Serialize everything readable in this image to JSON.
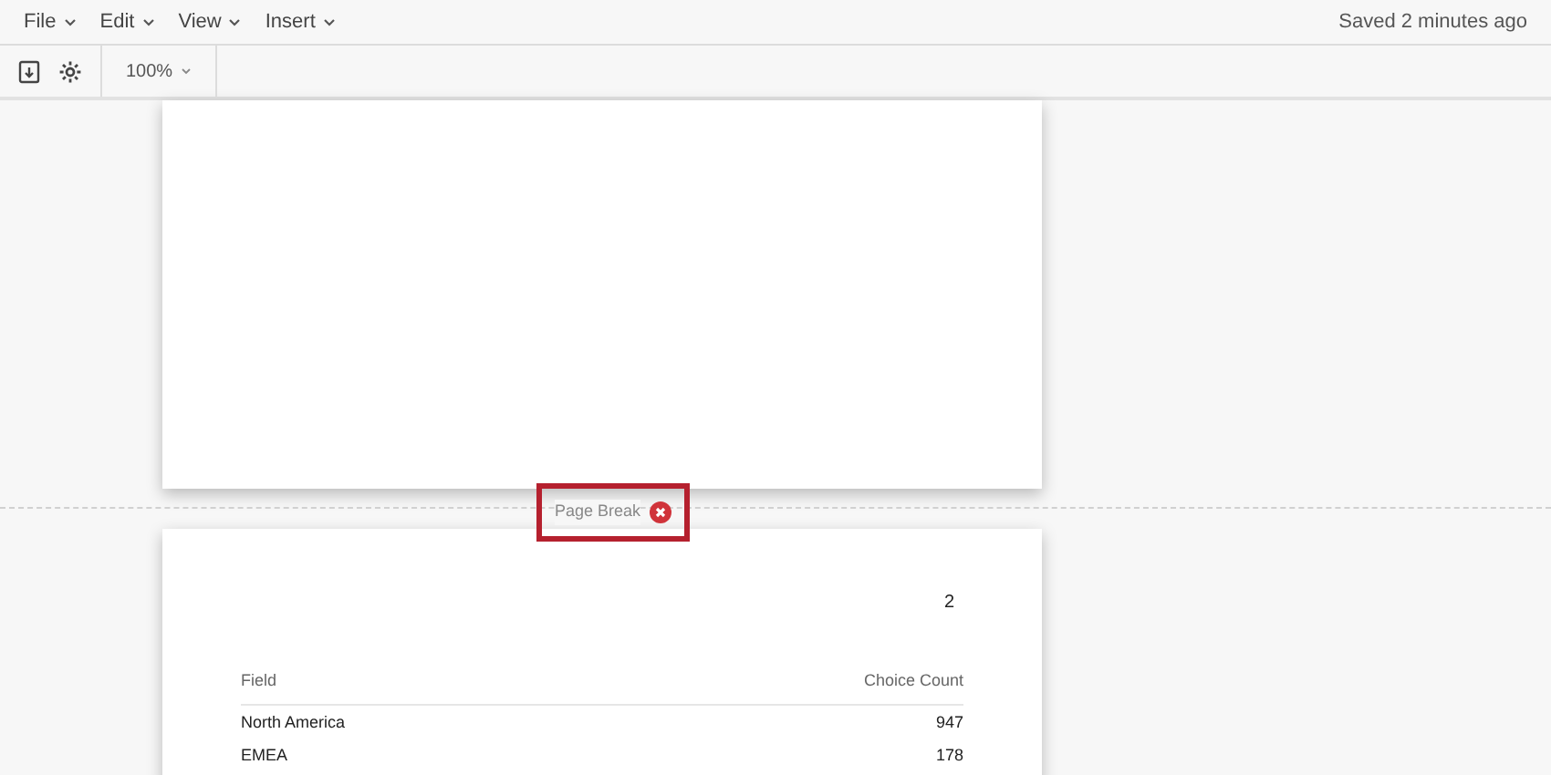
{
  "menu": [
    {
      "label": "File"
    },
    {
      "label": "Edit"
    },
    {
      "label": "View"
    },
    {
      "label": "Insert"
    }
  ],
  "save_status": "Saved 2 minutes ago",
  "toolbar": {
    "zoom": "100%"
  },
  "page_break": {
    "label": "Page Break",
    "highlighted": true
  },
  "page_2": {
    "page_number": "2",
    "table": {
      "columns": [
        "Field",
        "Choice Count"
      ],
      "rows": [
        [
          "North America",
          "947"
        ],
        [
          "EMEA",
          "178"
        ]
      ]
    }
  }
}
